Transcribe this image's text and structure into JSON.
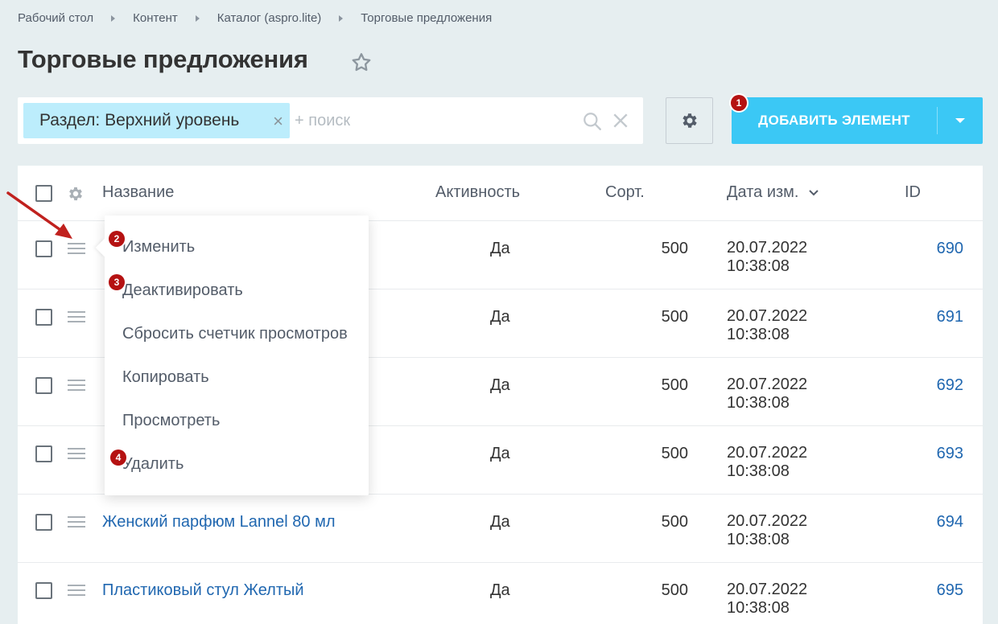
{
  "breadcrumb": [
    "Рабочий стол",
    "Контент",
    "Каталог (aspro.lite)",
    "Торговые предложения"
  ],
  "page_title": "Торговые предложения",
  "filter": {
    "chip": "Раздел: Верхний уровень",
    "search_placeholder": "+ поиск"
  },
  "toolbar": {
    "add_label": "ДОБАВИТЬ ЭЛЕМЕНТ"
  },
  "badges": [
    "1",
    "2",
    "3",
    "4"
  ],
  "columns": {
    "name": "Название",
    "active": "Активность",
    "sort": "Сорт.",
    "date": "Дата изм.",
    "id": "ID"
  },
  "rows": [
    {
      "name": "",
      "active": "Да",
      "sort": "500",
      "date": "20.07.2022",
      "time": "10:38:08",
      "id": "690"
    },
    {
      "name": "",
      "active": "Да",
      "sort": "500",
      "date": "20.07.2022",
      "time": "10:38:08",
      "id": "691"
    },
    {
      "name": "",
      "active": "Да",
      "sort": "500",
      "date": "20.07.2022",
      "time": "10:38:08",
      "id": "692"
    },
    {
      "name": "",
      "active": "Да",
      "sort": "500",
      "date": "20.07.2022",
      "time": "10:38:08",
      "id": "693"
    },
    {
      "name": "Женский парфюм Lannel 80 мл",
      "active": "Да",
      "sort": "500",
      "date": "20.07.2022",
      "time": "10:38:08",
      "id": "694"
    },
    {
      "name": "Пластиковый стул Желтый",
      "active": "Да",
      "sort": "500",
      "date": "20.07.2022",
      "time": "10:38:08",
      "id": "695"
    }
  ],
  "context_menu": [
    "Изменить",
    "Деактивировать",
    "Сбросить счетчик просмотров",
    "Копировать",
    "Просмотреть",
    "Удалить"
  ],
  "colors": {
    "accent": "#3bc8f5",
    "link": "#2067b0",
    "badge": "#b51212",
    "background": "#e6eef0"
  }
}
